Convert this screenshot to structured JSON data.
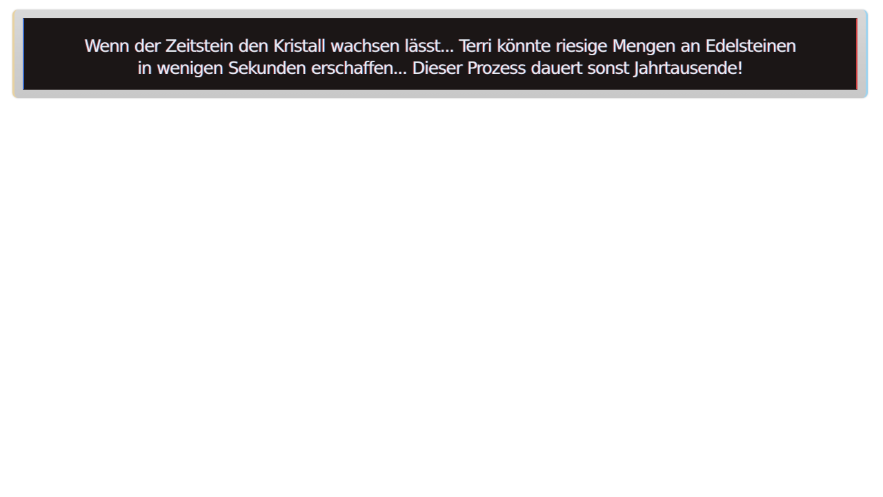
{
  "dialog": {
    "line1": "Wenn der Zeitstein den Kristall wachsen lässt... Terri könnte riesige Mengen an Edelsteinen",
    "line2": "in wenigen Sekunden erschaffen... Dieser Prozess dauert sonst Jahrtausende!"
  },
  "colors": {
    "frame": "#d0d0d0",
    "box": "#1b1616",
    "text": "#e8ecf4"
  }
}
